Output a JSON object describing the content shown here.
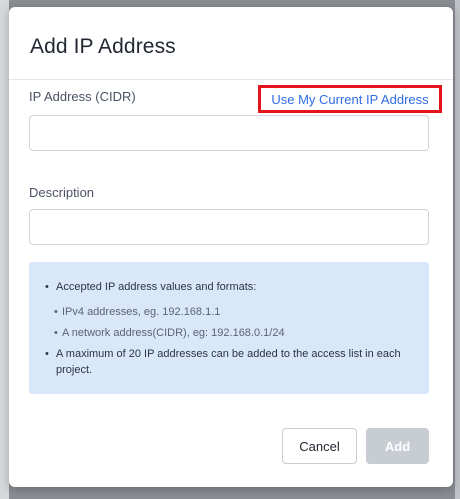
{
  "dialog": {
    "title": "Add IP Address",
    "ip_field": {
      "label": "IP Address (CIDR)",
      "value": "",
      "placeholder": ""
    },
    "use_current_ip_link": "Use My Current IP Address",
    "description_field": {
      "label": "Description",
      "value": "",
      "placeholder": ""
    },
    "info": {
      "item1": "Accepted IP address values and formats:",
      "sub_items": [
        "IPv4 addresses, eg. 192.168.1.1",
        "A network address(CIDR), eg: 192.168.0.1/24"
      ],
      "item2": "A maximum of 20 IP addresses can be added to the access list in each project."
    },
    "buttons": {
      "cancel": "Cancel",
      "add": "Add"
    }
  },
  "colors": {
    "link": "#2f6ce5",
    "highlight_border": "#e3141e",
    "info_background": "#d9e7fb",
    "disabled_button": "#c8ccd3"
  }
}
